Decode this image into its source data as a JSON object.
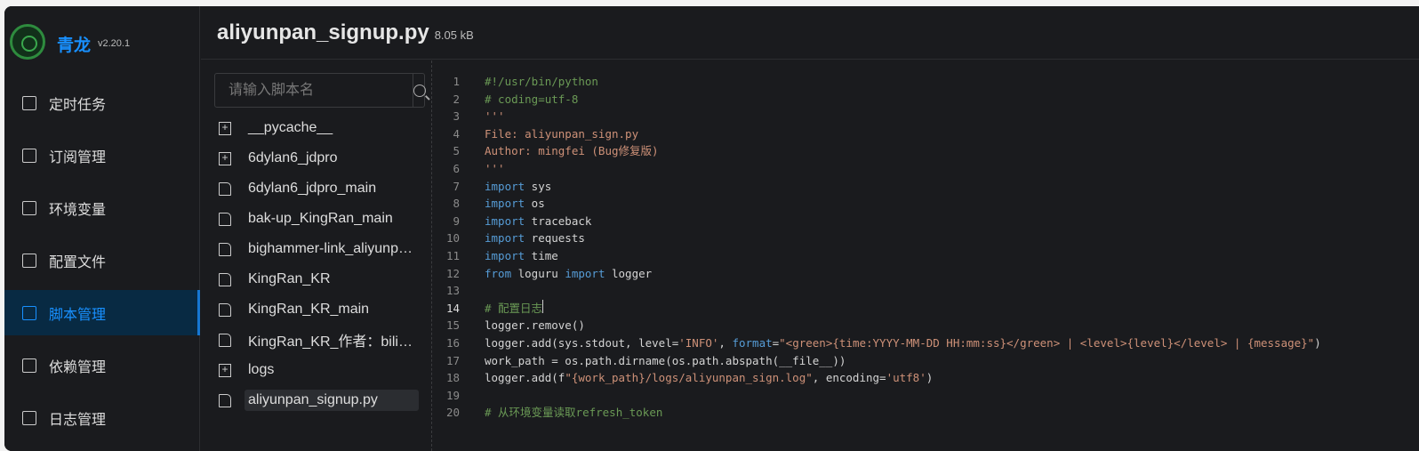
{
  "sidebar": {
    "brand": "青龙",
    "version": "v2.20.1",
    "items": [
      {
        "label": "定时任务",
        "icon": "calendar-clock-icon"
      },
      {
        "label": "订阅管理",
        "icon": "subscription-icon"
      },
      {
        "label": "环境变量",
        "icon": "monitor-icon"
      },
      {
        "label": "配置文件",
        "icon": "sliders-icon"
      },
      {
        "label": "脚本管理",
        "icon": "terminal-icon",
        "active": true
      },
      {
        "label": "依赖管理",
        "icon": "list-circle-icon"
      },
      {
        "label": "日志管理",
        "icon": "log-file-icon"
      }
    ]
  },
  "header": {
    "title": "aliyunpan_signup.py",
    "size": "8.05 kB"
  },
  "tree": {
    "search_placeholder": "请输入脚本名",
    "items": [
      {
        "label": "__pycache__",
        "type": "folder"
      },
      {
        "label": "6dylan6_jdpro",
        "type": "folder"
      },
      {
        "label": "6dylan6_jdpro_main",
        "type": "file"
      },
      {
        "label": "bak-up_KingRan_main",
        "type": "file"
      },
      {
        "label": "bighammer-link_aliyunpan_main",
        "type": "file"
      },
      {
        "label": "KingRan_KR",
        "type": "file"
      },
      {
        "label": "KingRan_KR_main",
        "type": "file"
      },
      {
        "label": "KingRan_KR_作者：bilibili",
        "type": "file"
      },
      {
        "label": "logs",
        "type": "folder"
      },
      {
        "label": "aliyunpan_signup.py",
        "type": "file",
        "selected": true
      }
    ]
  },
  "editor": {
    "current_line": 14,
    "lines": [
      [
        [
          "c",
          "#!/usr/bin/python"
        ]
      ],
      [
        [
          "c",
          "# coding=utf-8"
        ]
      ],
      [
        [
          "s",
          "'''"
        ]
      ],
      [
        [
          "s",
          "File: aliyunpan_sign.py"
        ]
      ],
      [
        [
          "s",
          "Author: mingfei (Bug修复版)"
        ]
      ],
      [
        [
          "s",
          "'''"
        ]
      ],
      [
        [
          "k",
          "import"
        ],
        [
          "t",
          " sys"
        ]
      ],
      [
        [
          "k",
          "import"
        ],
        [
          "t",
          " os"
        ]
      ],
      [
        [
          "k",
          "import"
        ],
        [
          "t",
          " traceback"
        ]
      ],
      [
        [
          "k",
          "import"
        ],
        [
          "t",
          " requests"
        ]
      ],
      [
        [
          "k",
          "import"
        ],
        [
          "t",
          " time"
        ]
      ],
      [
        [
          "k",
          "from"
        ],
        [
          "t",
          " loguru "
        ],
        [
          "k",
          "import"
        ],
        [
          "t",
          " logger"
        ]
      ],
      [],
      [
        [
          "c",
          "# 配置日志"
        ]
      ],
      [
        [
          "t",
          "logger.remove()"
        ]
      ],
      [
        [
          "t",
          "logger.add(sys.stdout, level="
        ],
        [
          "s",
          "'INFO'"
        ],
        [
          "t",
          ", "
        ],
        [
          "k",
          "format"
        ],
        [
          "t",
          "="
        ],
        [
          "s",
          "\"<green>{time:YYYY-MM-DD HH:mm:ss}</green> | <level>{level}</level> | {message}\""
        ],
        [
          "t",
          ")"
        ]
      ],
      [
        [
          "t",
          "work_path = os.path.dirname(os.path.abspath(__file__))"
        ]
      ],
      [
        [
          "t",
          "logger.add(f"
        ],
        [
          "s",
          "\"{work_path}/logs/aliyunpan_sign.log\""
        ],
        [
          "t",
          ", encoding="
        ],
        [
          "s",
          "'utf8'"
        ],
        [
          "t",
          ")"
        ]
      ],
      [],
      [
        [
          "c",
          "# 从环境变量读取refresh_token"
        ]
      ]
    ]
  }
}
